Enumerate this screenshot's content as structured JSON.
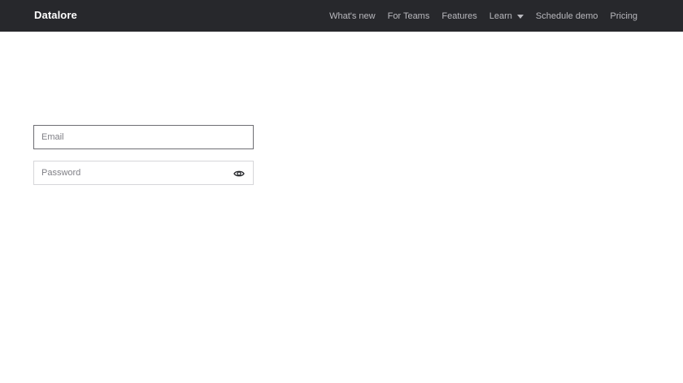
{
  "header": {
    "logo": "Datalore",
    "nav": {
      "whats_new": "What's new",
      "for_teams": "For Teams",
      "features": "Features",
      "learn": "Learn",
      "schedule_demo": "Schedule demo",
      "pricing": "Pricing"
    }
  },
  "login": {
    "email": {
      "value": "",
      "placeholder": "Email"
    },
    "password": {
      "value": "",
      "placeholder": "Password",
      "toggle_icon": "eye-icon"
    }
  },
  "colors": {
    "header_bg": "#27282c",
    "logo_text": "#ffffff",
    "nav_text": "#b9b9be",
    "field_border": "#d6d6d9",
    "field_border_active": "#6e6e73"
  }
}
